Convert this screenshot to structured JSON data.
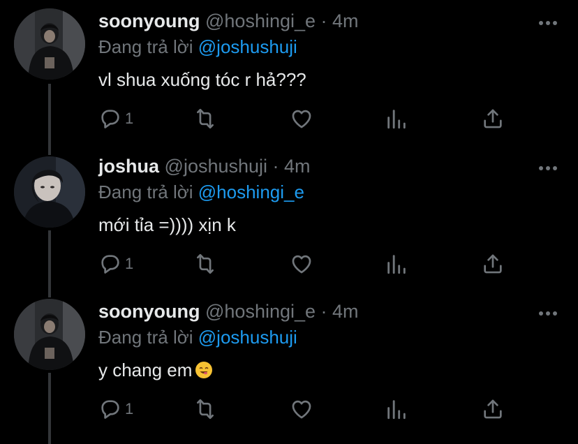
{
  "tweets": [
    {
      "name": "soonyoung",
      "handle": "@hoshingi_e",
      "separator": " · ",
      "time": "4m",
      "reply_prefix": "Đang trả lời ",
      "reply_to": "@joshushuji",
      "text": "vl shua xuống tóc r hả???",
      "reply_count": "1"
    },
    {
      "name": "joshua",
      "handle": "@joshushuji",
      "separator": " · ",
      "time": "4m",
      "reply_prefix": "Đang trả lời ",
      "reply_to": "@hoshingi_e",
      "text": "mới tỉa =)))) xịn k",
      "reply_count": "1"
    },
    {
      "name": "soonyoung",
      "handle": "@hoshingi_e",
      "separator": " · ",
      "time": "4m",
      "reply_prefix": "Đang trả lời ",
      "reply_to": "@joshushuji",
      "text": "y chang em",
      "emoji": "smiling-face-emoji",
      "reply_count": "1"
    }
  ],
  "colors": {
    "background": "#000000",
    "text": "#e7e9ea",
    "muted": "#71767b",
    "accent": "#1d9bf0"
  },
  "icons": [
    "reply-icon",
    "retweet-icon",
    "like-icon",
    "views-icon",
    "share-icon",
    "more-icon"
  ]
}
